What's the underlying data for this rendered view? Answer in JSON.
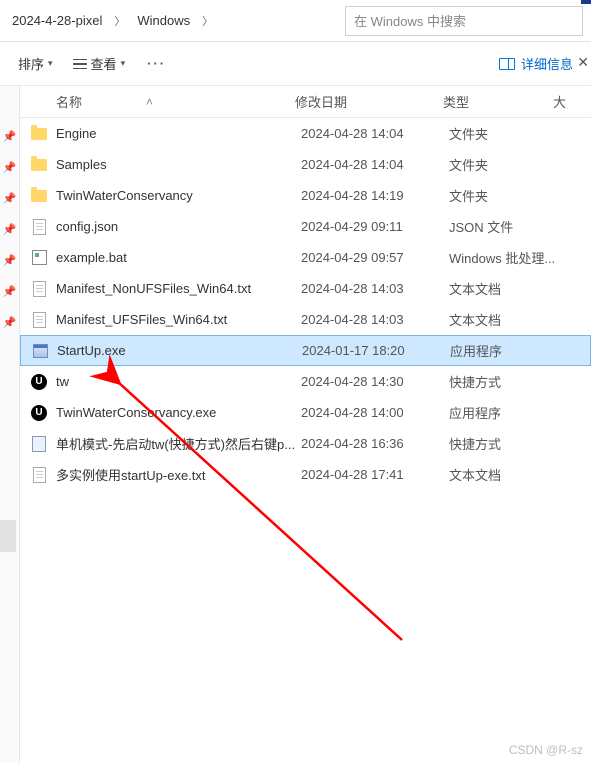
{
  "breadcrumb": {
    "item1": "2024-4-28-pixel",
    "item2": "Windows"
  },
  "search": {
    "placeholder": "在 Windows 中搜索"
  },
  "toolbar": {
    "sort": "排序",
    "view": "查看",
    "details": "详细信息"
  },
  "columns": {
    "name": "名称",
    "date": "修改日期",
    "type": "类型",
    "size": "大"
  },
  "files": [
    {
      "icon": "folder",
      "name": "Engine",
      "date": "2024-04-28 14:04",
      "type": "文件夹"
    },
    {
      "icon": "folder",
      "name": "Samples",
      "date": "2024-04-28 14:04",
      "type": "文件夹"
    },
    {
      "icon": "folder",
      "name": "TwinWaterConservancy",
      "date": "2024-04-28 14:19",
      "type": "文件夹"
    },
    {
      "icon": "file",
      "name": "config.json",
      "date": "2024-04-29 09:11",
      "type": "JSON 文件"
    },
    {
      "icon": "bat",
      "name": "example.bat",
      "date": "2024-04-29 09:57",
      "type": "Windows 批处理..."
    },
    {
      "icon": "file",
      "name": "Manifest_NonUFSFiles_Win64.txt",
      "date": "2024-04-28 14:03",
      "type": "文本文档"
    },
    {
      "icon": "file",
      "name": "Manifest_UFSFiles_Win64.txt",
      "date": "2024-04-28 14:03",
      "type": "文本文档"
    },
    {
      "icon": "exe",
      "name": "StartUp.exe",
      "date": "2024-01-17 18:20",
      "type": "应用程序",
      "selected": true
    },
    {
      "icon": "ue",
      "name": "tw",
      "date": "2024-04-28 14:30",
      "type": "快捷方式"
    },
    {
      "icon": "ue",
      "name": "TwinWaterConservancy.exe",
      "date": "2024-04-28 14:00",
      "type": "应用程序"
    },
    {
      "icon": "link",
      "name": "单机模式-先启动tw(快捷方式)然后右键p...",
      "date": "2024-04-28 16:36",
      "type": "快捷方式"
    },
    {
      "icon": "file",
      "name": "多实例使用startUp-exe.txt",
      "date": "2024-04-28 17:41",
      "type": "文本文档"
    }
  ],
  "watermark": "CSDN @R-sz"
}
